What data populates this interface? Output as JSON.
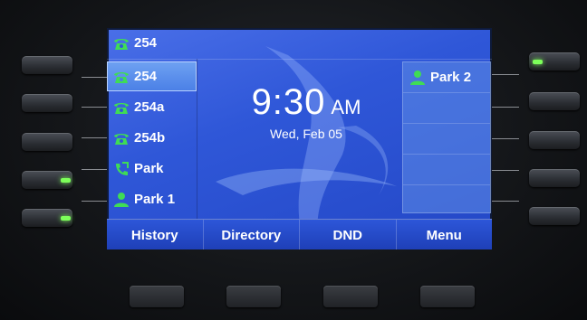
{
  "title_line": "254",
  "lines": [
    {
      "label": "254",
      "icon": "phone-icon",
      "selected": true
    },
    {
      "label": "254a",
      "icon": "phone-icon",
      "selected": false
    },
    {
      "label": "254b",
      "icon": "phone-icon",
      "selected": false
    },
    {
      "label": "Park",
      "icon": "park-call-icon",
      "selected": false
    },
    {
      "label": "Park 1",
      "icon": "contact-icon",
      "selected": false
    }
  ],
  "right_keys": [
    {
      "label": "Park 2",
      "icon": "contact-icon"
    },
    {
      "label": ""
    },
    {
      "label": ""
    },
    {
      "label": ""
    },
    {
      "label": ""
    }
  ],
  "clock": {
    "time": "9:30",
    "ampm": "AM",
    "date": "Wed, Feb 05"
  },
  "softkeys": [
    "History",
    "Directory",
    "DND",
    "Menu"
  ],
  "colors": {
    "screen": "#2f57d8",
    "led": "#7dff5a",
    "icon": "#3fdc55"
  }
}
